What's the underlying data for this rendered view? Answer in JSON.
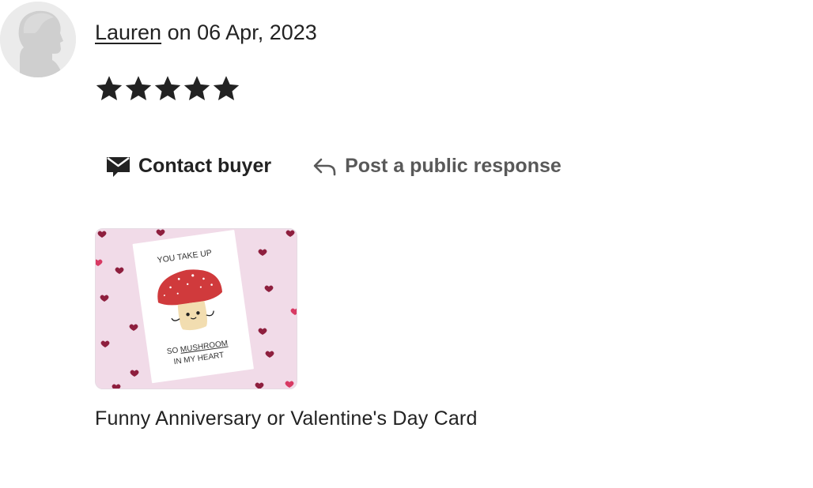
{
  "review": {
    "reviewer_name": "Lauren",
    "date_prefix": " on ",
    "date": "06 Apr, 2023",
    "rating": 5,
    "rating_max": 5
  },
  "actions": {
    "contact_label": "Contact buyer",
    "contact_icon": "envelope-icon",
    "public_response_label": "Post a public response",
    "public_response_icon": "reply-arrow-icon"
  },
  "listing": {
    "title": "Funny Anniversary or Valentine's Day Card",
    "card_text_top": "YOU TAKE UP",
    "card_text_line1_prefix": "SO ",
    "card_text_line1_emph": "MUSHROOM",
    "card_text_line2": "IN MY HEART"
  },
  "colors": {
    "text": "#222222",
    "muted": "#595959",
    "thumb_background": "#f1dbe8",
    "mushroom_cap": "#d03a3c"
  }
}
